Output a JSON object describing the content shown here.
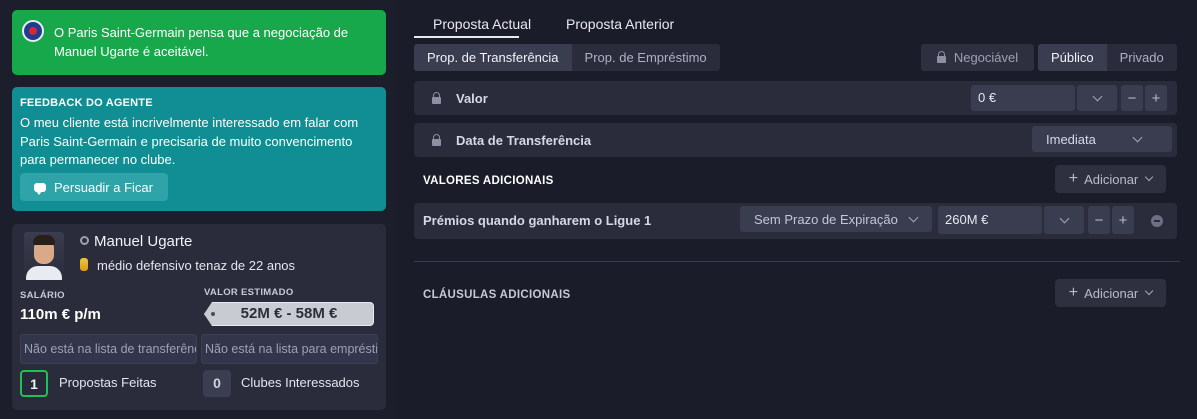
{
  "left": {
    "notice": {
      "text": "O Paris Saint-Germain pensa que a negociação de Manuel Ugarte é aceitável."
    },
    "agent_feedback": {
      "title": "FEEDBACK DO AGENTE",
      "text": "O meu cliente está incrivelmente interessado em falar com Paris Saint-Germain e precisaria de muito convencimento para permanecer no clube.",
      "button": "Persuadir a Ficar"
    },
    "player": {
      "name": "Manuel Ugarte",
      "description": "médio defensivo tenaz de 22 anos",
      "salary_label": "SALÁRIO",
      "salary": "110m € p/m",
      "value_label": "VALOR ESTIMADO",
      "value": "52M € - 58M €",
      "transfer_list": "Não está na lista de transferências",
      "loan_list": "Não está na lista para empréstimo",
      "offers_count": "1",
      "offers_label": "Propostas Feitas",
      "clubs_count": "0",
      "clubs_label": "Clubes Interessados"
    }
  },
  "right": {
    "tabs": [
      "Proposta Actual",
      "Proposta Anterior"
    ],
    "type_tabs": [
      "Prop. de Transferência",
      "Prop. de Empréstimo"
    ],
    "negotiable": "Negociável",
    "visibility": [
      "Público",
      "Privado"
    ],
    "value_row": {
      "label": "Valor",
      "value": "0 €"
    },
    "date_row": {
      "label": "Data de Transferência",
      "value": "Imediata"
    },
    "additional_values_title": "VALORES ADICIONAIS",
    "add_label": "Adicionar",
    "bonus_row": {
      "label": "Prémios quando ganharem o Ligue 1",
      "expiry": "Sem Prazo de Expiração",
      "value": "260M €"
    },
    "clauses_title": "CLÁUSULAS ADICIONAIS",
    "minus": "−",
    "plus": "+"
  }
}
